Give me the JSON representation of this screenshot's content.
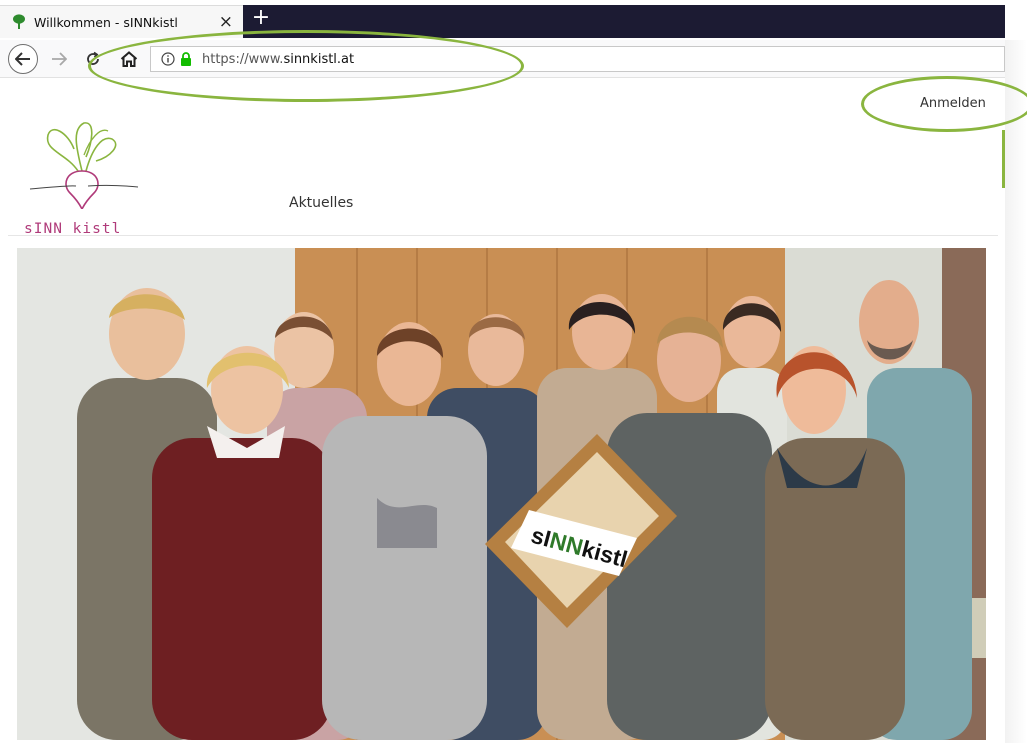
{
  "browser": {
    "tab_title": "Willkommen - sINNkistl",
    "tab_close": "×",
    "new_tab": "+",
    "url_prefix": "https://www.",
    "url_host": "sinnkistl.at"
  },
  "header": {
    "login_label": "Anmelden",
    "logo_text": "sINN kistl",
    "nav_items": [
      {
        "label": "Aktuelles"
      }
    ]
  },
  "hero": {
    "basket_label_1": "sI",
    "basket_label_2": "NN",
    "basket_label_3": "kistl"
  },
  "colors": {
    "annotation": "#8ab53f",
    "logo_purple": "#b03b7a",
    "logo_green": "#8ab53f",
    "tab_strip": "#1c1b33"
  },
  "icons": {
    "tab": "tree-favicon-icon",
    "back": "arrow-left-icon",
    "forward": "arrow-right-icon",
    "reload": "reload-icon",
    "home": "home-icon",
    "info": "info-icon",
    "lock": "lock-icon"
  }
}
